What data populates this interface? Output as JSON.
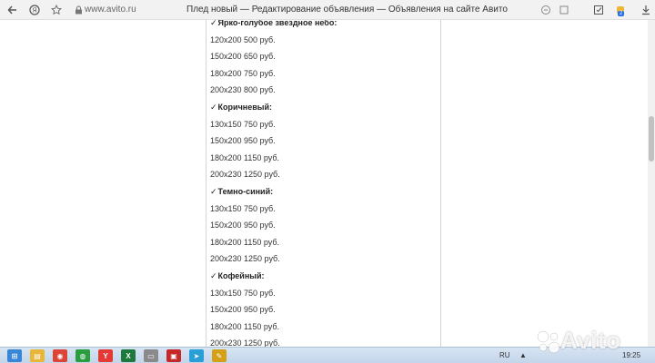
{
  "browser": {
    "url": "www.avito.ru",
    "title": "Плед новый — Редактирование объявления — Объявления на сайте Авито",
    "extension_badge": "2",
    "icons": {
      "back": "arrow-left-icon",
      "forward": "yandex-icon",
      "bookmark": "star-icon",
      "lock": "lock-icon"
    }
  },
  "content": {
    "rows": [
      {
        "kind": "heading",
        "text": "Ярко-голубое звездное небо:"
      },
      {
        "kind": "item",
        "text": "120x200 500 руб."
      },
      {
        "kind": "item",
        "text": "150x200 650 руб."
      },
      {
        "kind": "item",
        "text": "180x200 750 руб."
      },
      {
        "kind": "item",
        "text": "200x230 800 руб."
      },
      {
        "kind": "heading",
        "text": "Коричневый:"
      },
      {
        "kind": "item",
        "text": "130x150 750 руб."
      },
      {
        "kind": "item",
        "text": "150x200 950 руб."
      },
      {
        "kind": "item",
        "text": "180x200 1150 руб."
      },
      {
        "kind": "item",
        "text": "200x230 1250 руб."
      },
      {
        "kind": "heading",
        "text": "Темно-синий:"
      },
      {
        "kind": "item",
        "text": "130x150 750 руб."
      },
      {
        "kind": "item",
        "text": "150x200 950 руб."
      },
      {
        "kind": "item",
        "text": "180x200 1150 руб."
      },
      {
        "kind": "item",
        "text": "200x230 1250 руб."
      },
      {
        "kind": "heading",
        "text": "Кофейный:"
      },
      {
        "kind": "item",
        "text": "130x150 750 руб."
      },
      {
        "kind": "item",
        "text": "150x200 950 руб."
      },
      {
        "kind": "item",
        "text": "180x200 1150 руб."
      },
      {
        "kind": "item",
        "text": "200x230 1250 руб."
      }
    ]
  },
  "taskbar": {
    "language": "RU",
    "time": "19:25",
    "apps": [
      {
        "name": "start-icon",
        "color": "#3a86d6",
        "glyph": "⊞"
      },
      {
        "name": "explorer-icon",
        "color": "#e8b73a",
        "glyph": "▤"
      },
      {
        "name": "chrome-icon",
        "color": "#db4437",
        "glyph": "◉"
      },
      {
        "name": "app-icon",
        "color": "#2a9d3f",
        "glyph": "◍"
      },
      {
        "name": "yandex-browser-icon",
        "color": "#e53935",
        "glyph": "Y"
      },
      {
        "name": "excel-icon",
        "color": "#1e7a3c",
        "glyph": "X"
      },
      {
        "name": "window-icon",
        "color": "#8a8a8a",
        "glyph": "▭"
      },
      {
        "name": "media-icon",
        "color": "#c62828",
        "glyph": "▣"
      },
      {
        "name": "telegram-icon",
        "color": "#2a9fd6",
        "glyph": "➤"
      },
      {
        "name": "paint-icon",
        "color": "#d4a017",
        "glyph": "✎"
      }
    ]
  },
  "watermark": "Avito"
}
